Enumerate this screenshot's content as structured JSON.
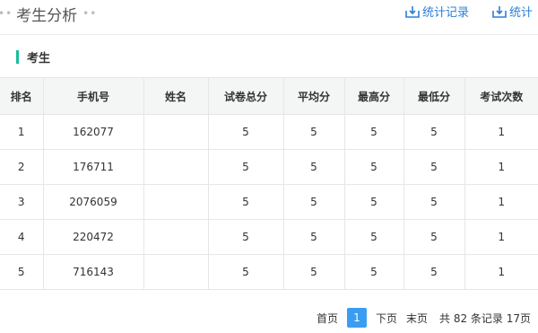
{
  "header": {
    "title": "考生分析",
    "actions": [
      {
        "label": "统计记录",
        "icon": "download-icon"
      },
      {
        "label": "统计",
        "icon": "download-icon"
      }
    ],
    "accent_color": "#2b7fd7"
  },
  "section": {
    "label": "考生",
    "marker_color": "#1abc9c"
  },
  "table": {
    "columns": [
      "排名",
      "手机号",
      "姓名",
      "试卷总分",
      "平均分",
      "最高分",
      "最低分",
      "考试次数"
    ],
    "rows": [
      [
        "1",
        "162077",
        "",
        "5",
        "5",
        "5",
        "5",
        "1"
      ],
      [
        "2",
        "176711",
        "",
        "5",
        "5",
        "5",
        "5",
        "1"
      ],
      [
        "3",
        "2076059",
        "",
        "5",
        "5",
        "5",
        "5",
        "1"
      ],
      [
        "4",
        "220472",
        "",
        "5",
        "5",
        "5",
        "5",
        "1"
      ],
      [
        "5",
        "716143",
        "",
        "5",
        "5",
        "5",
        "5",
        "1"
      ]
    ]
  },
  "pagination": {
    "first": "首页",
    "current": "1",
    "next": "下页",
    "last": "末页",
    "summary": "共 82 条记录 17页",
    "active_color": "#3a9df2"
  }
}
